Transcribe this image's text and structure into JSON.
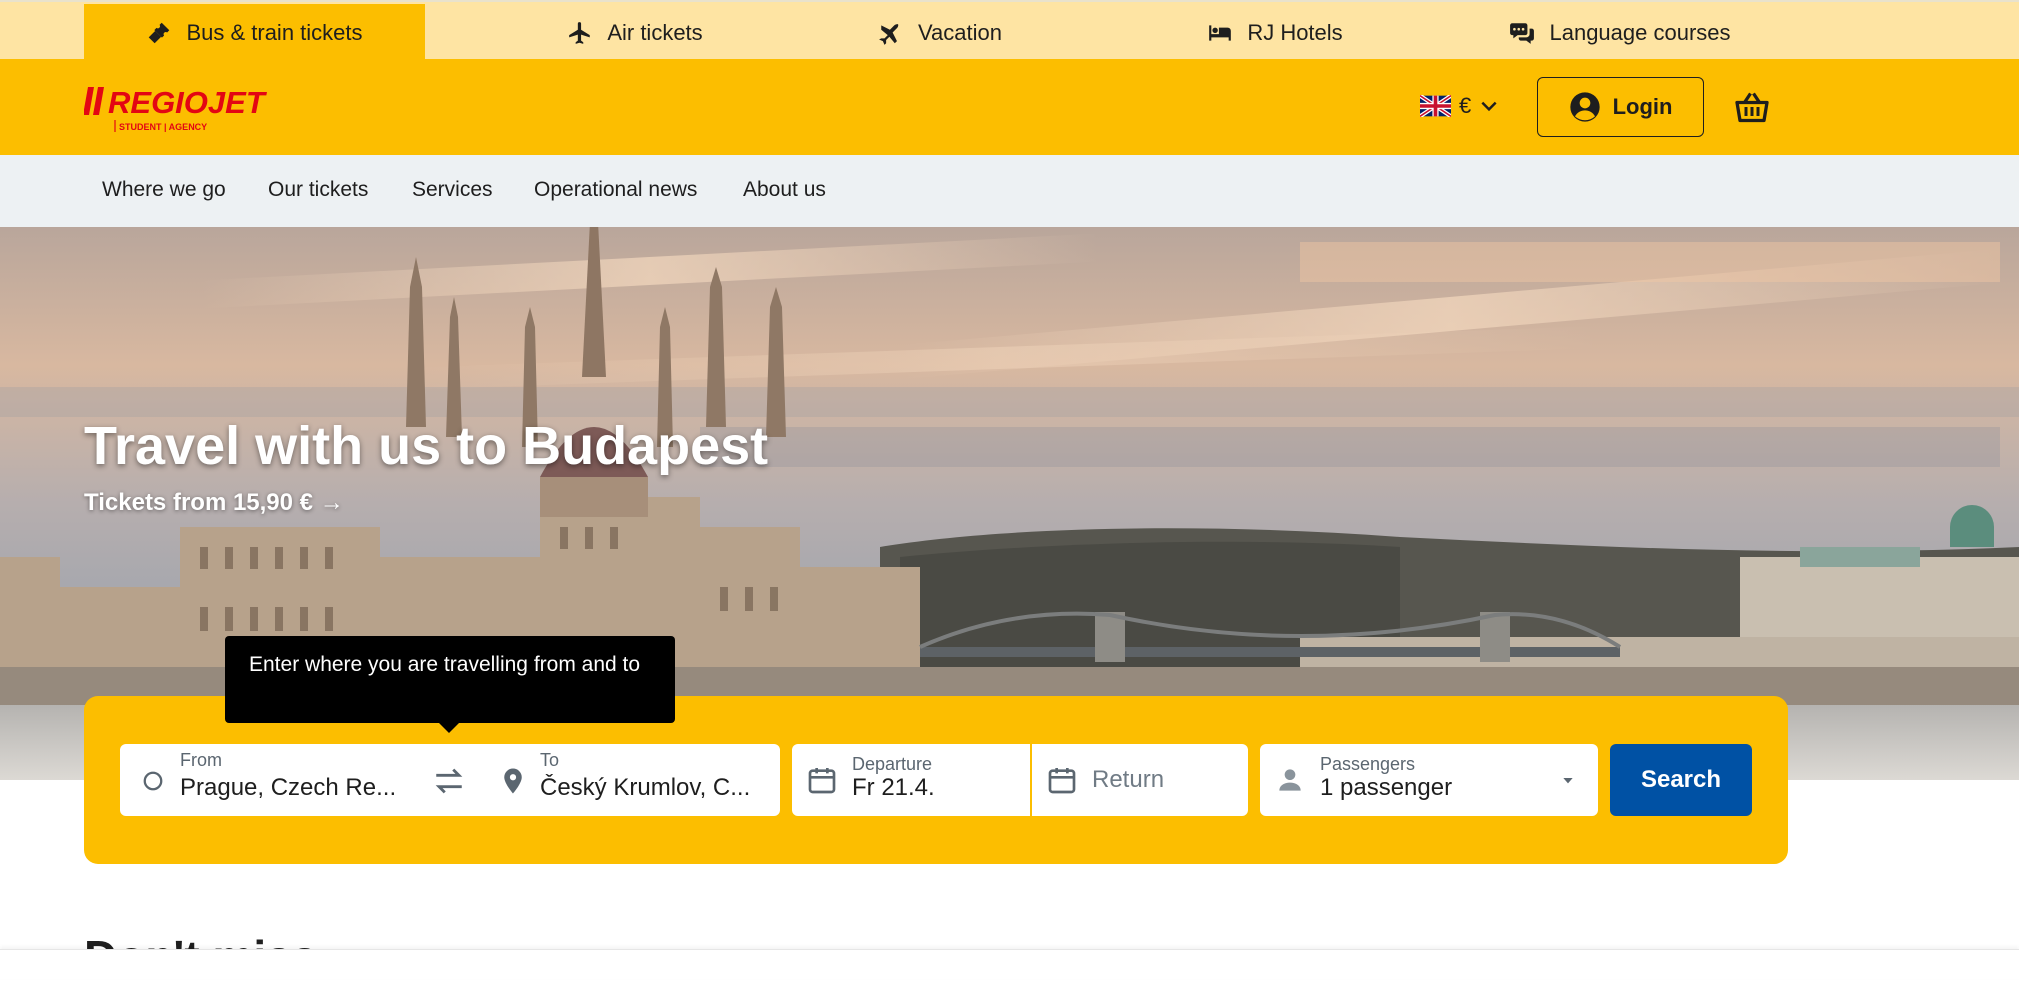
{
  "product_tabs": [
    {
      "label": "Bus & train tickets",
      "icon": "ticket-icon",
      "active": true
    },
    {
      "label": "Air tickets",
      "icon": "airplane-icon",
      "active": false
    },
    {
      "label": "Vacation",
      "icon": "plane-vacation-icon",
      "active": false
    },
    {
      "label": "RJ Hotels",
      "icon": "bed-icon",
      "active": false
    },
    {
      "label": "Language courses",
      "icon": "chat-bubbles-icon",
      "active": false
    }
  ],
  "header": {
    "logo_text": "REGIOJET",
    "logo_subtext": "STUDENT | AGENCY",
    "currency": "€",
    "login_label": "Login",
    "colors": {
      "brand_yellow": "#fcbe00",
      "brand_red": "#e30613",
      "brand_blue": "#0051a4"
    }
  },
  "nav": {
    "items": [
      "Where we go",
      "Our tickets",
      "Services",
      "Operational news",
      "About us"
    ]
  },
  "hero": {
    "title": "Travel with us to Budapest",
    "subtitle": "Tickets from 15,90 € →"
  },
  "tooltip": {
    "text": "Enter where you are travelling from and to"
  },
  "search": {
    "from_label": "From",
    "from_value": "Prague, Czech Re...",
    "to_label": "To",
    "to_value": "Český Krumlov, C...",
    "departure_label": "Departure",
    "departure_value": "Fr 21.4.",
    "return_placeholder": "Return",
    "passengers_label": "Passengers",
    "passengers_value": "1 passenger",
    "search_label": "Search"
  },
  "section": {
    "heading": "Don't miss"
  }
}
